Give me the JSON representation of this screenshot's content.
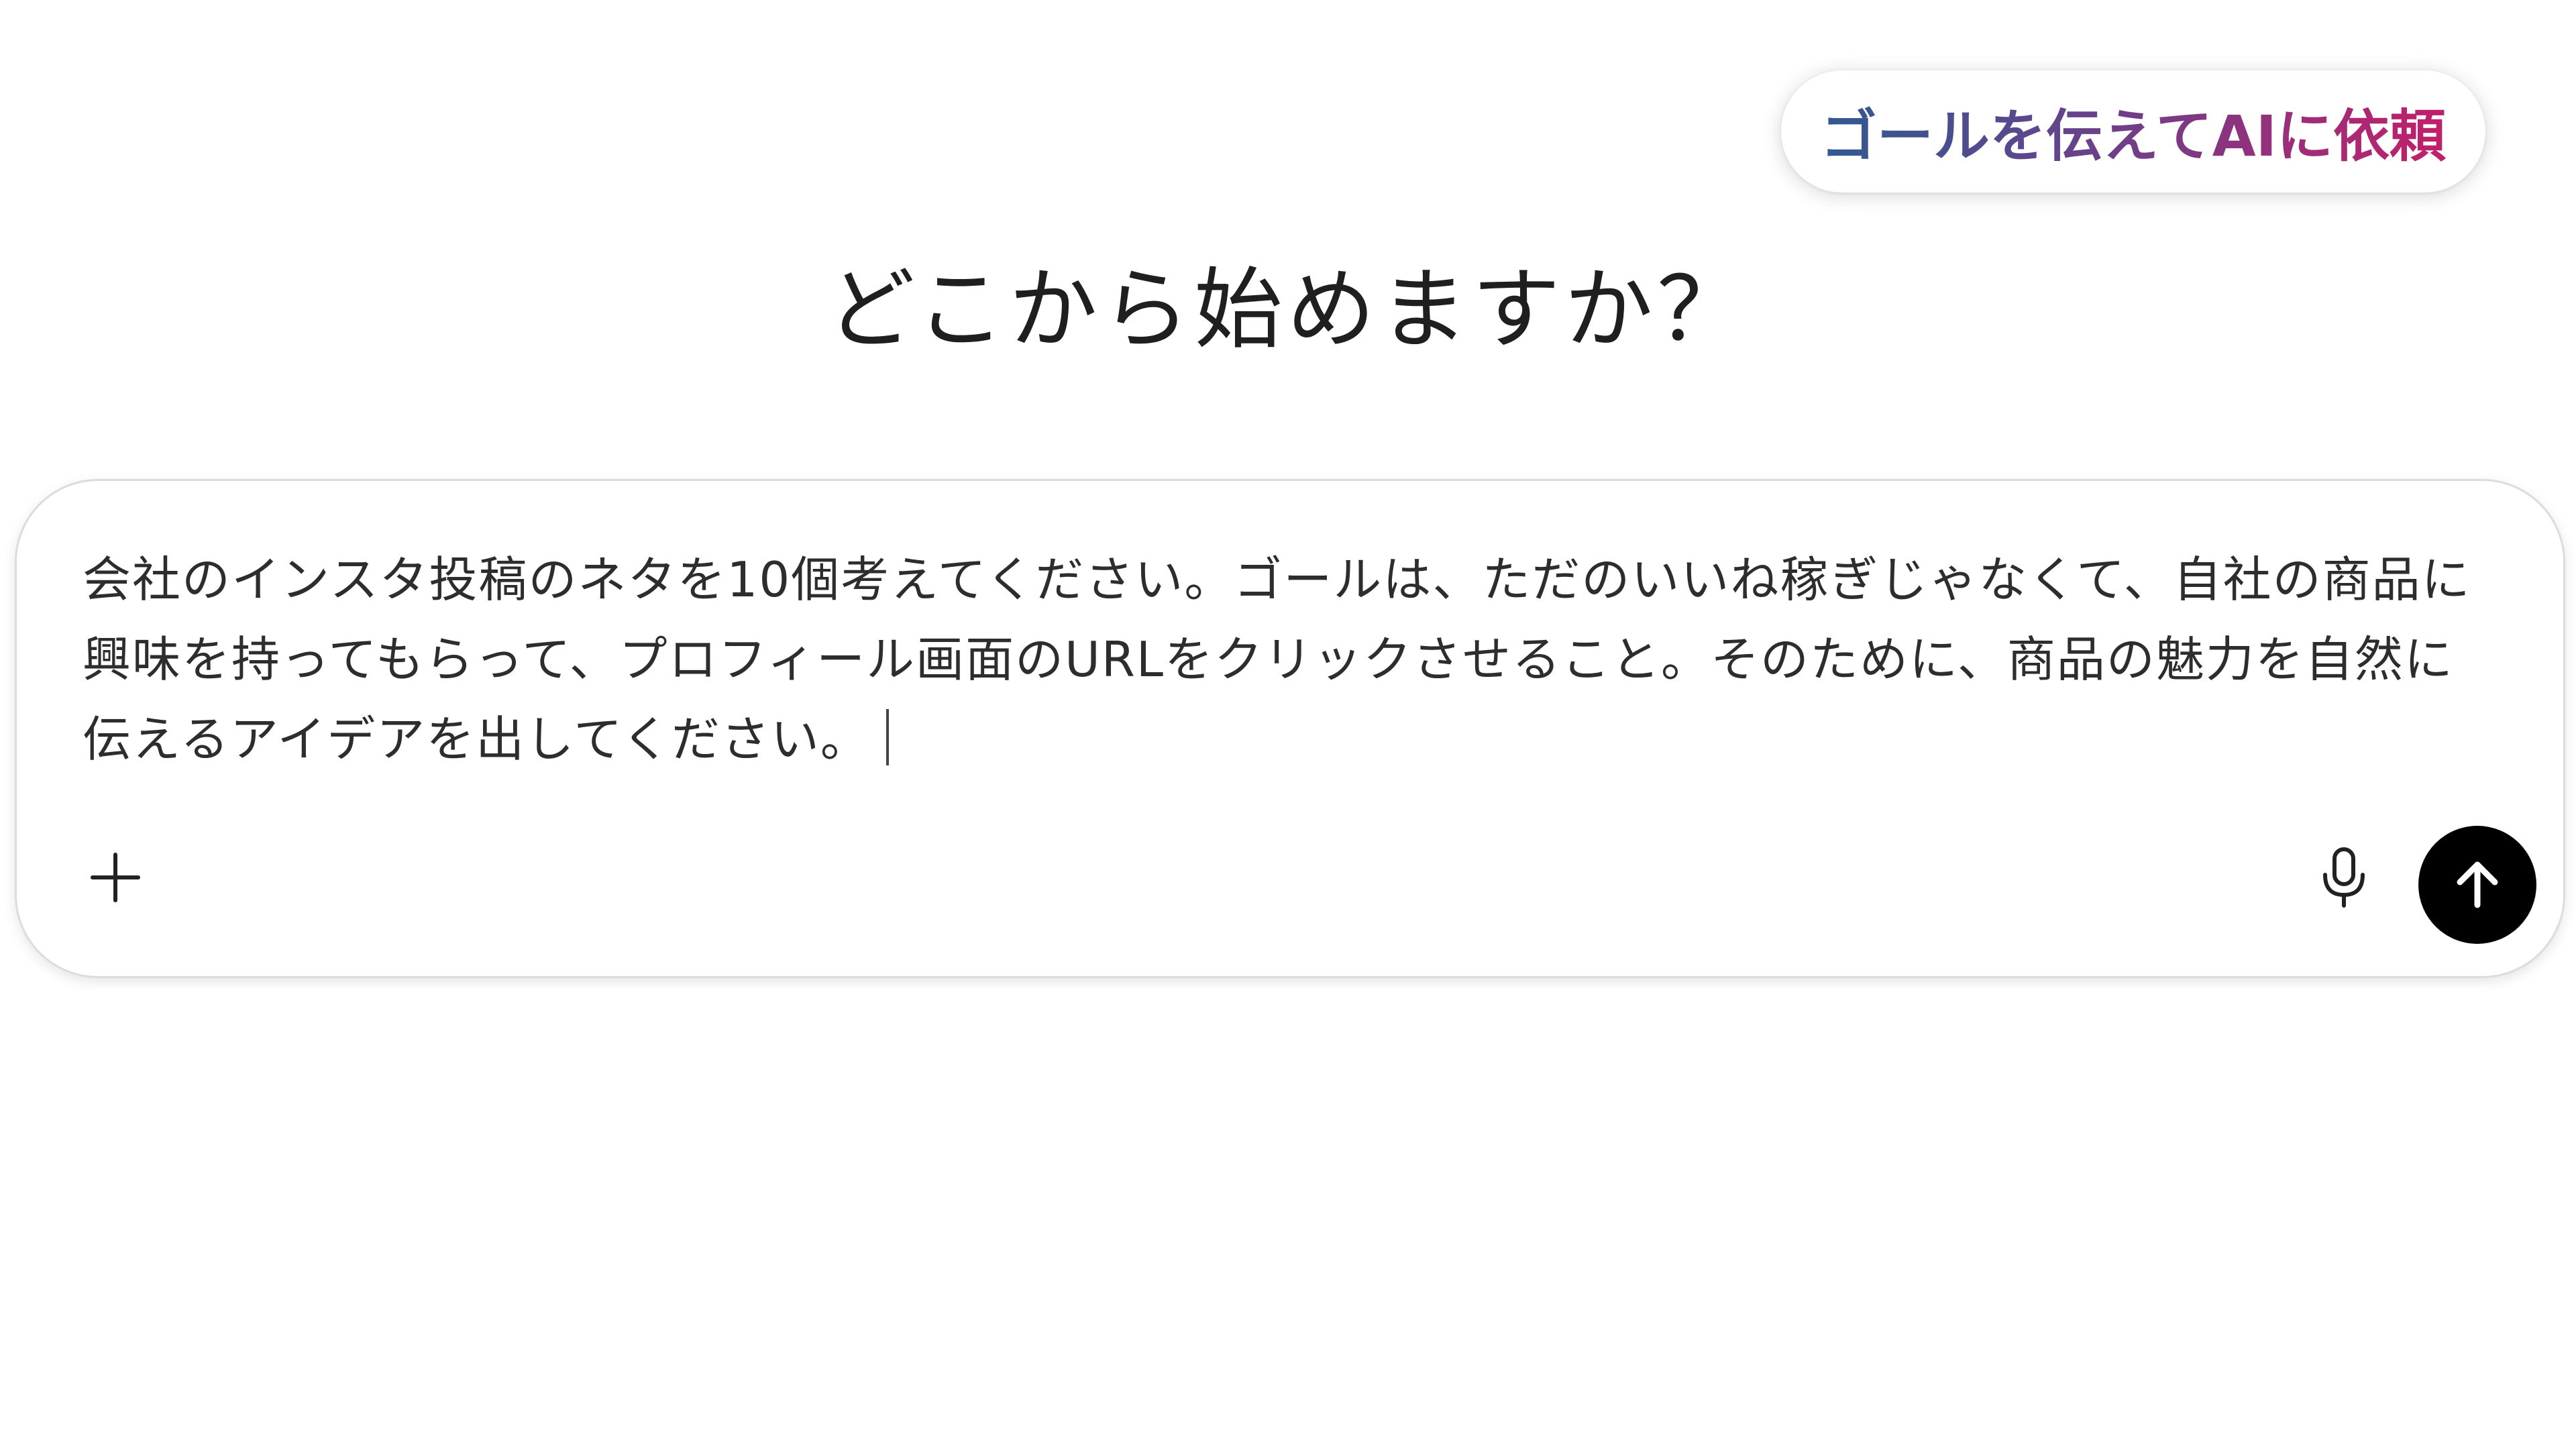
{
  "badge": {
    "label": "ゴールを伝えてAIに依頼"
  },
  "heading": {
    "text": "どこから始めますか？"
  },
  "composer": {
    "value": "会社のインスタ投稿のネタを10個考えてください。ゴールは、ただのいいね稼ぎじゃなくて、自社の商品に興味を持ってもらって、プロフィール画面のURLをクリックさせること。そのために、商品の魅力を自然に伝えるアイデアを出してください。"
  },
  "icons": {
    "plus": "plus-icon",
    "mic": "microphone-icon",
    "send": "arrow-up-icon"
  },
  "colors": {
    "badge_gradient_start": "#2f5a93",
    "badge_gradient_end": "#c21f6a",
    "send_button": "#000000"
  }
}
